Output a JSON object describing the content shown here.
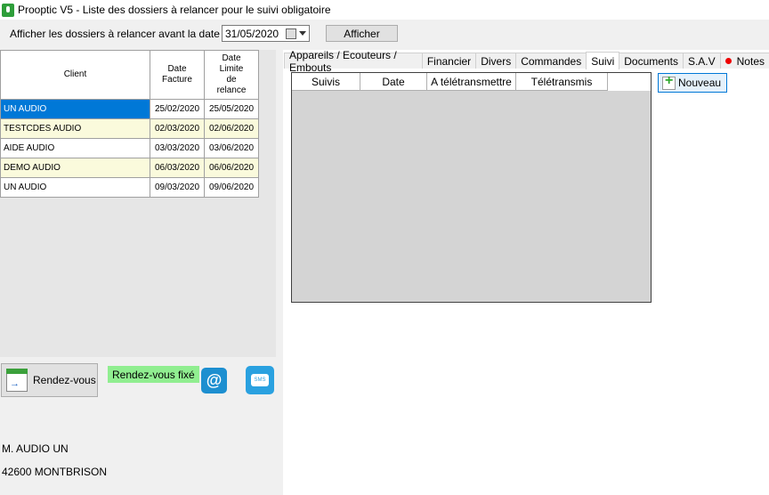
{
  "window": {
    "title": "Prooptic V5 - Liste des dossiers à relancer pour le suivi obligatoire"
  },
  "filter": {
    "label": "Afficher les dossiers à relancer avant la date du :",
    "date": "31/05/2020",
    "button": "Afficher"
  },
  "grid": {
    "headers": {
      "client": "Client",
      "date_facture": "Date\nFacture",
      "date_limite": "Date\nLimite\nde\nrelance"
    },
    "rows": [
      {
        "client": "UN AUDIO",
        "facture": "25/02/2020",
        "limite": "25/05/2020"
      },
      {
        "client": "TESTCDES AUDIO",
        "facture": "02/03/2020",
        "limite": "02/06/2020"
      },
      {
        "client": "AIDE AUDIO",
        "facture": "03/03/2020",
        "limite": "03/06/2020"
      },
      {
        "client": "DEMO AUDIO",
        "facture": "06/03/2020",
        "limite": "06/06/2020"
      },
      {
        "client": "UN AUDIO",
        "facture": "09/03/2020",
        "limite": "09/06/2020"
      }
    ]
  },
  "actions": {
    "rdv": "Rendez-vous",
    "rdv_fixed": "Rendez-vous fixé",
    "email_symbol": "@",
    "sms_symbol": "SMS"
  },
  "client": {
    "name": "M. AUDIO UN",
    "city": "42600 MONTBRISON"
  },
  "tabs": [
    "Appareils / Ecouteurs / Embouts",
    "Financier",
    "Divers",
    "Commandes",
    "Suivi",
    "Documents",
    "S.A.V",
    "Notes"
  ],
  "suivi": {
    "columns": [
      "Suivis",
      "Date",
      "A télétransmettre",
      "Télétransmis"
    ],
    "new_button": "Nouveau"
  },
  "colors": {
    "selection": "#0078d7",
    "row_alt": "#fafadc",
    "rdv_fixed_bg": "#90ee90",
    "notes_dot": "#ee0000"
  }
}
